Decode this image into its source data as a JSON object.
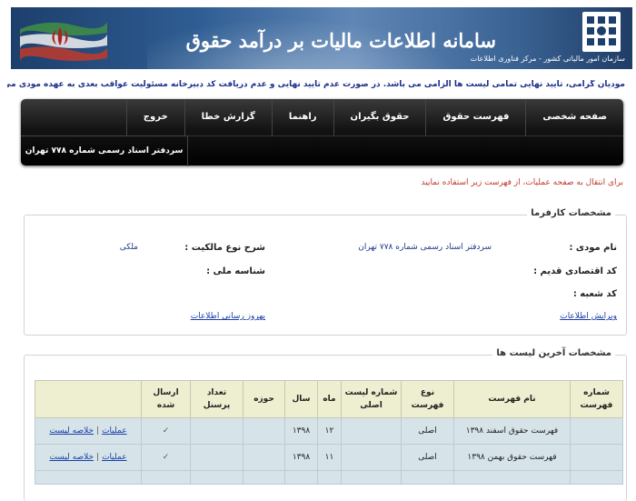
{
  "header": {
    "title": "سامانه اطلاعات مالیات بر درآمد حقوق",
    "logo_text": "سازمان امور مالیاتی کشور - مرکز فناوری اطلاعات"
  },
  "notice": "مودیان گرامی، تایید نهایی تمامی لیست ها الزامی می باشد. در صورت عدم تایید نهایی و عدم دریافت کد دبیرخانه مسئولیت عواقب بعدی به عهده مودی می باشد",
  "nav": {
    "items": [
      "صفحه شخصی",
      "فهرست حقوق",
      "حقوق بگیران",
      "راهنما",
      "گزارش خطا",
      "خروج"
    ],
    "office": "سردفتر اسناد رسمی شماره ۷۷۸ تهران"
  },
  "redirect": "برای انتقال به صفحه عملیات، از فهرست زیر استفاده نمایید",
  "employer": {
    "legend": "مشخصات کارفرما",
    "name_label": "نام مودی :",
    "name_value": "سردفتر اسناد رسمی شماره ۷۷۸ تهران",
    "old_code_label": "کد اقتصادی قدیم :",
    "branch_label": "کد شعبه :",
    "ownership_label": "شرح نوع مالکیت :",
    "ownership_value": "ملکی",
    "national_id_label": "شناسه ملی :",
    "edit_link": "ویرایش اطلاعات",
    "update_link": "بهروز رسانی اطلاعات"
  },
  "lists": {
    "legend": "مشخصات آخرین لیست ها",
    "columns": [
      "شماره فهرست",
      "نام فهرست",
      "نوع فهرست",
      "شماره لیست اصلی",
      "ماه",
      "سال",
      "حوزه",
      "تعداد پرسنل",
      "ارسال شده",
      ""
    ],
    "rows": [
      {
        "name": "فهرست حقوق اسفند ۱۳۹۸",
        "type": "اصلی",
        "month": "۱۲",
        "year": "۱۳۹۸",
        "sent": "✓",
        "ops": "عملیات",
        "summary": "خلاصه لیست"
      },
      {
        "name": "فهرست حقوق بهمن ۱۳۹۸",
        "type": "اصلی",
        "month": "۱۱",
        "year": "۱۳۹۸",
        "sent": "✓",
        "ops": "عملیات",
        "summary": "خلاصه لیست"
      }
    ]
  }
}
